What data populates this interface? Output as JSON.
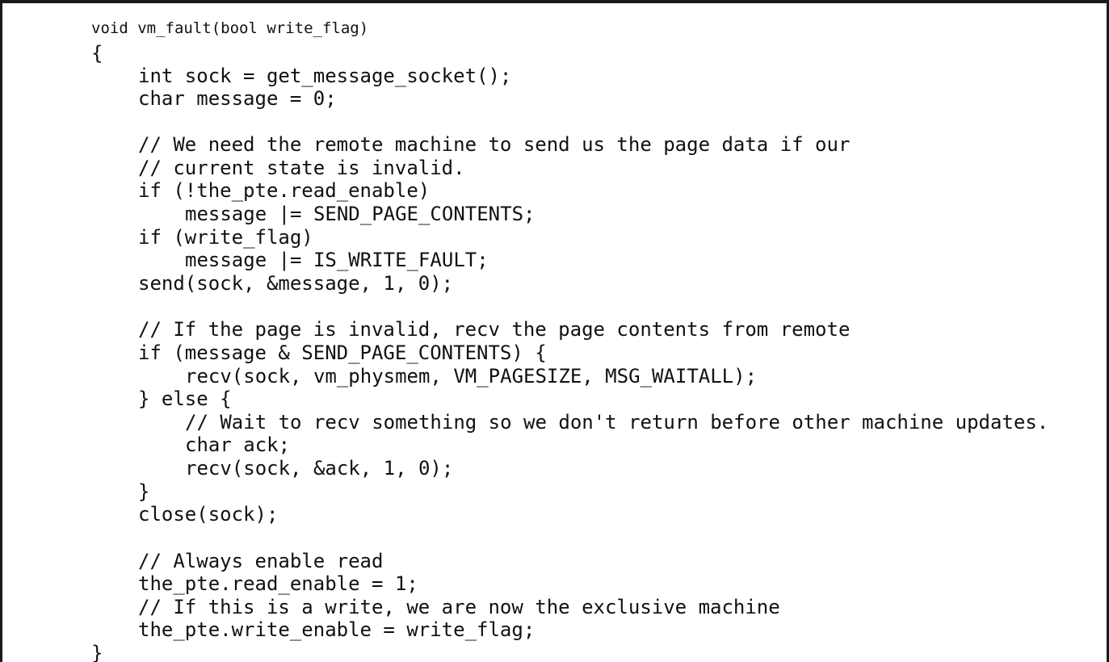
{
  "code": {
    "lines": [
      "void vm_fault(bool write_flag)",
      "{",
      "int sock = get_message_socket();",
      "char message = 0;",
      "",
      "// We need the remote machine to send us the page data if our",
      "// current state is invalid.",
      "if (!the_pte.read_enable)",
      "message |= SEND_PAGE_CONTENTS;",
      "if (write_flag)",
      "message |= IS_WRITE_FAULT;",
      "send(sock, &message, 1, 0);",
      "",
      "// If the page is invalid, recv the page contents from remote",
      "if (message & SEND_PAGE_CONTENTS) {",
      "recv(sock, vm_physmem, VM_PAGESIZE, MSG_WAITALL);",
      "} else {",
      "// Wait to recv something so we don't return before other machine updates.",
      "char ack;",
      "recv(sock, &ack, 1, 0);",
      "}",
      "close(sock);",
      "",
      "// Always enable read",
      "the_pte.read_enable = 1;",
      "// If this is a write, we are now the exclusive machine",
      "the_pte.write_enable = write_flag;",
      "}"
    ]
  }
}
